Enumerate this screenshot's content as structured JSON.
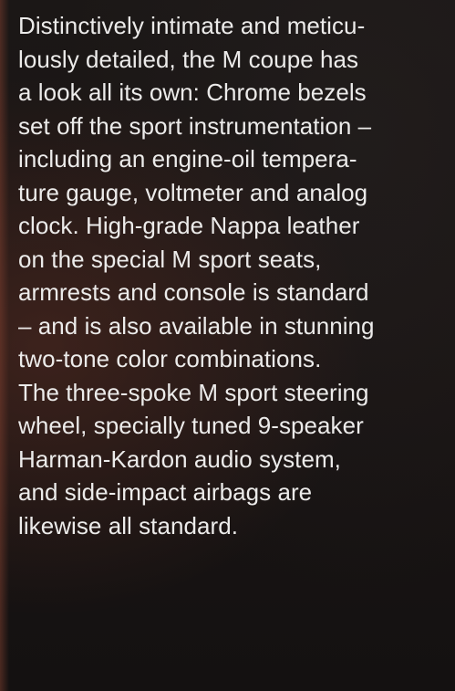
{
  "document": {
    "lines": [
      "Distinctively intimate and meticu-",
      "lously detailed, the M coupe has",
      "a look all its own: Chrome bezels",
      "set off the sport instrumentation –",
      "including an engine-oil tempera-",
      "ture gauge, voltmeter and analog",
      "clock. High-grade Nappa leather",
      "on the special M sport seats,",
      "armrests and console is standard",
      "– and is also available in stunning",
      "two-tone color combinations.",
      "The three-spoke M sport steering",
      "wheel, specially tuned 9-speaker",
      "Harman-Kardon audio system,",
      "and side-impact airbags are",
      "likewise all standard."
    ]
  }
}
